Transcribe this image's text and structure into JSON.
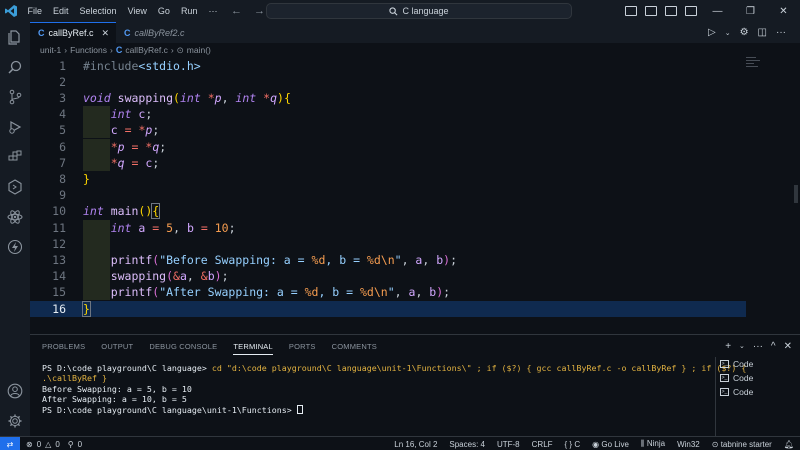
{
  "menu": [
    "File",
    "Edit",
    "Selection",
    "View",
    "Go",
    "Run"
  ],
  "window": {
    "search_text": "C language"
  },
  "tabs": [
    {
      "label": "callByRef.c",
      "active": true
    },
    {
      "label": "callByRef2.c",
      "active": false
    }
  ],
  "breadcrumb": [
    "unit-1",
    "Functions",
    "callByRef.c",
    "main()"
  ],
  "editor": {
    "current_line": 16,
    "line_numbers": [
      "1",
      "2",
      "3",
      "4",
      "5",
      "6",
      "7",
      "8",
      "9",
      "10",
      "11",
      "12",
      "13",
      "14",
      "15",
      "16"
    ]
  },
  "panel": {
    "tabs": [
      "PROBLEMS",
      "OUTPUT",
      "DEBUG CONSOLE",
      "TERMINAL",
      "PORTS",
      "COMMENTS"
    ],
    "active_tab": "TERMINAL",
    "terminal_prompt": "PS D:\\code playground\\C language>",
    "terminal_command": "cd \"d:\\code playground\\C language\\unit-1\\Functions\\\" ; if ($?) { gcc callByRef.c -o callByRef } ; if ($?) {",
    "terminal_command_cont": ".\\callByRef }",
    "terminal_output": [
      "Before Swapping: a = 5, b = 10",
      "After Swapping: a = 10, b = 5"
    ],
    "terminal_final_prompt": "PS D:\\code playground\\C language\\unit-1\\Functions>",
    "terminal_instances": [
      "Code",
      "Code",
      "Code"
    ]
  },
  "statusbar": {
    "errors": "0",
    "warnings": "0",
    "ports": "0",
    "position": "Ln 16, Col 2",
    "spaces": "Spaces: 4",
    "encoding": "UTF-8",
    "eol": "CRLF",
    "language": "C",
    "golive": "Go Live",
    "ninja": "Ninja",
    "platform": "Win32",
    "tabnine": "tabnine starter"
  },
  "colors": {
    "accent": "#1f6feb",
    "current_line": "#0f2a4f",
    "keyword": "#f47067",
    "number": "#f69d50",
    "string": "#96d0ff"
  }
}
